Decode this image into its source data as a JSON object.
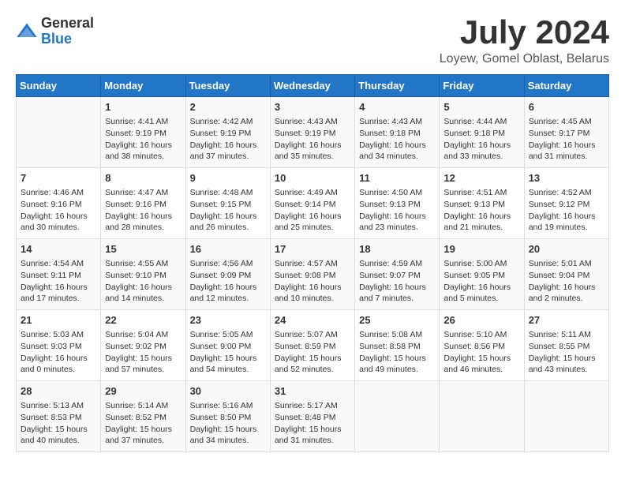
{
  "logo": {
    "general": "General",
    "blue": "Blue"
  },
  "title": "July 2024",
  "location": "Loyew, Gomel Oblast, Belarus",
  "days_header": [
    "Sunday",
    "Monday",
    "Tuesday",
    "Wednesday",
    "Thursday",
    "Friday",
    "Saturday"
  ],
  "weeks": [
    [
      {
        "day": "",
        "content": ""
      },
      {
        "day": "1",
        "content": "Sunrise: 4:41 AM\nSunset: 9:19 PM\nDaylight: 16 hours\nand 38 minutes."
      },
      {
        "day": "2",
        "content": "Sunrise: 4:42 AM\nSunset: 9:19 PM\nDaylight: 16 hours\nand 37 minutes."
      },
      {
        "day": "3",
        "content": "Sunrise: 4:43 AM\nSunset: 9:19 PM\nDaylight: 16 hours\nand 35 minutes."
      },
      {
        "day": "4",
        "content": "Sunrise: 4:43 AM\nSunset: 9:18 PM\nDaylight: 16 hours\nand 34 minutes."
      },
      {
        "day": "5",
        "content": "Sunrise: 4:44 AM\nSunset: 9:18 PM\nDaylight: 16 hours\nand 33 minutes."
      },
      {
        "day": "6",
        "content": "Sunrise: 4:45 AM\nSunset: 9:17 PM\nDaylight: 16 hours\nand 31 minutes."
      }
    ],
    [
      {
        "day": "7",
        "content": "Sunrise: 4:46 AM\nSunset: 9:16 PM\nDaylight: 16 hours\nand 30 minutes."
      },
      {
        "day": "8",
        "content": "Sunrise: 4:47 AM\nSunset: 9:16 PM\nDaylight: 16 hours\nand 28 minutes."
      },
      {
        "day": "9",
        "content": "Sunrise: 4:48 AM\nSunset: 9:15 PM\nDaylight: 16 hours\nand 26 minutes."
      },
      {
        "day": "10",
        "content": "Sunrise: 4:49 AM\nSunset: 9:14 PM\nDaylight: 16 hours\nand 25 minutes."
      },
      {
        "day": "11",
        "content": "Sunrise: 4:50 AM\nSunset: 9:13 PM\nDaylight: 16 hours\nand 23 minutes."
      },
      {
        "day": "12",
        "content": "Sunrise: 4:51 AM\nSunset: 9:13 PM\nDaylight: 16 hours\nand 21 minutes."
      },
      {
        "day": "13",
        "content": "Sunrise: 4:52 AM\nSunset: 9:12 PM\nDaylight: 16 hours\nand 19 minutes."
      }
    ],
    [
      {
        "day": "14",
        "content": "Sunrise: 4:54 AM\nSunset: 9:11 PM\nDaylight: 16 hours\nand 17 minutes."
      },
      {
        "day": "15",
        "content": "Sunrise: 4:55 AM\nSunset: 9:10 PM\nDaylight: 16 hours\nand 14 minutes."
      },
      {
        "day": "16",
        "content": "Sunrise: 4:56 AM\nSunset: 9:09 PM\nDaylight: 16 hours\nand 12 minutes."
      },
      {
        "day": "17",
        "content": "Sunrise: 4:57 AM\nSunset: 9:08 PM\nDaylight: 16 hours\nand 10 minutes."
      },
      {
        "day": "18",
        "content": "Sunrise: 4:59 AM\nSunset: 9:07 PM\nDaylight: 16 hours\nand 7 minutes."
      },
      {
        "day": "19",
        "content": "Sunrise: 5:00 AM\nSunset: 9:05 PM\nDaylight: 16 hours\nand 5 minutes."
      },
      {
        "day": "20",
        "content": "Sunrise: 5:01 AM\nSunset: 9:04 PM\nDaylight: 16 hours\nand 2 minutes."
      }
    ],
    [
      {
        "day": "21",
        "content": "Sunrise: 5:03 AM\nSunset: 9:03 PM\nDaylight: 16 hours\nand 0 minutes."
      },
      {
        "day": "22",
        "content": "Sunrise: 5:04 AM\nSunset: 9:02 PM\nDaylight: 15 hours\nand 57 minutes."
      },
      {
        "day": "23",
        "content": "Sunrise: 5:05 AM\nSunset: 9:00 PM\nDaylight: 15 hours\nand 54 minutes."
      },
      {
        "day": "24",
        "content": "Sunrise: 5:07 AM\nSunset: 8:59 PM\nDaylight: 15 hours\nand 52 minutes."
      },
      {
        "day": "25",
        "content": "Sunrise: 5:08 AM\nSunset: 8:58 PM\nDaylight: 15 hours\nand 49 minutes."
      },
      {
        "day": "26",
        "content": "Sunrise: 5:10 AM\nSunset: 8:56 PM\nDaylight: 15 hours\nand 46 minutes."
      },
      {
        "day": "27",
        "content": "Sunrise: 5:11 AM\nSunset: 8:55 PM\nDaylight: 15 hours\nand 43 minutes."
      }
    ],
    [
      {
        "day": "28",
        "content": "Sunrise: 5:13 AM\nSunset: 8:53 PM\nDaylight: 15 hours\nand 40 minutes."
      },
      {
        "day": "29",
        "content": "Sunrise: 5:14 AM\nSunset: 8:52 PM\nDaylight: 15 hours\nand 37 minutes."
      },
      {
        "day": "30",
        "content": "Sunrise: 5:16 AM\nSunset: 8:50 PM\nDaylight: 15 hours\nand 34 minutes."
      },
      {
        "day": "31",
        "content": "Sunrise: 5:17 AM\nSunset: 8:48 PM\nDaylight: 15 hours\nand 31 minutes."
      },
      {
        "day": "",
        "content": ""
      },
      {
        "day": "",
        "content": ""
      },
      {
        "day": "",
        "content": ""
      }
    ]
  ]
}
